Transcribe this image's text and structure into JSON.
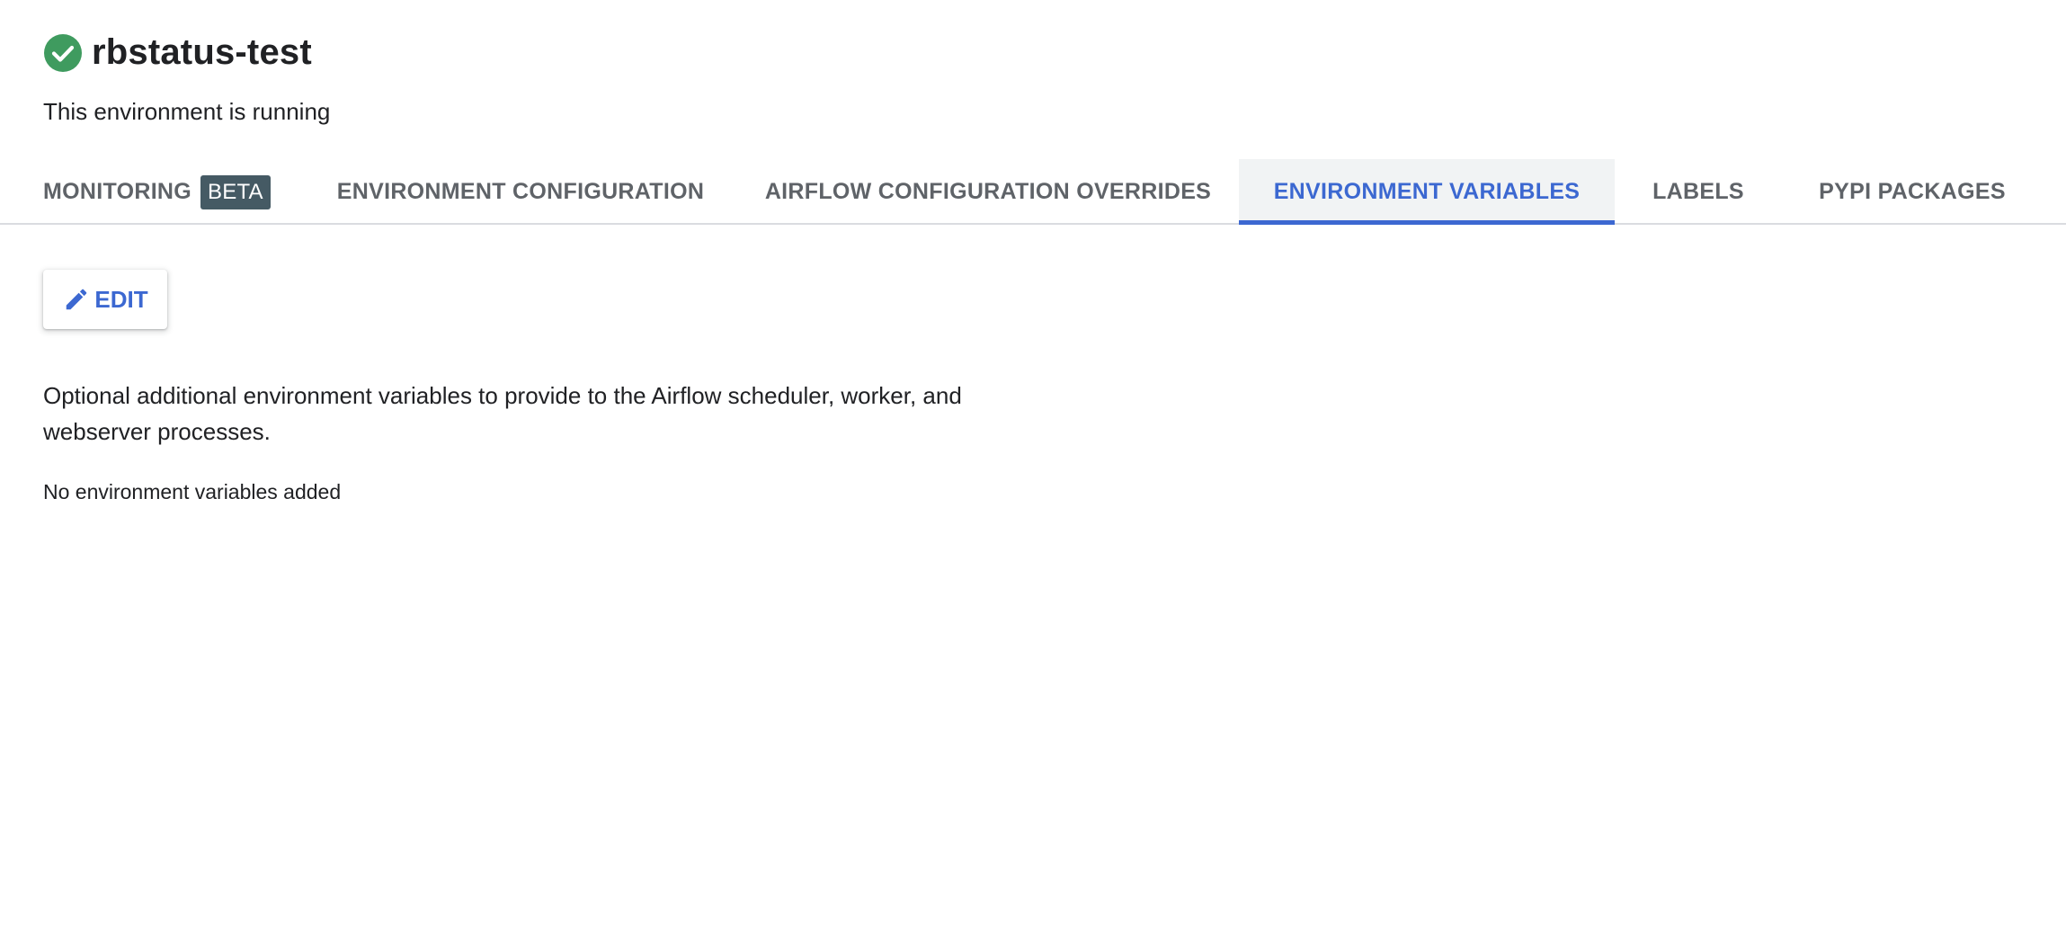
{
  "environment": {
    "name": "rbstatus-test",
    "status_text": "This environment is running",
    "status_icon": "check-circle-icon",
    "status_color": "#3f9b5f"
  },
  "tabs": [
    {
      "label": "MONITORING",
      "badge": "BETA",
      "active": false
    },
    {
      "label": "ENVIRONMENT CONFIGURATION",
      "active": false
    },
    {
      "label": "AIRFLOW CONFIGURATION OVERRIDES",
      "active": false
    },
    {
      "label": "ENVIRONMENT VARIABLES",
      "active": true
    },
    {
      "label": "LABELS",
      "active": false
    },
    {
      "label": "PYPI PACKAGES",
      "active": false
    }
  ],
  "toolbar": {
    "edit_label": "EDIT",
    "edit_icon": "pencil-icon"
  },
  "content": {
    "description": "Optional additional environment variables to provide to the Airflow scheduler, worker, and webserver processes.",
    "empty_message": "No environment variables added"
  },
  "colors": {
    "accent": "#3c68d1",
    "badge_bg": "#455a64",
    "tab_text": "#5f6368"
  }
}
